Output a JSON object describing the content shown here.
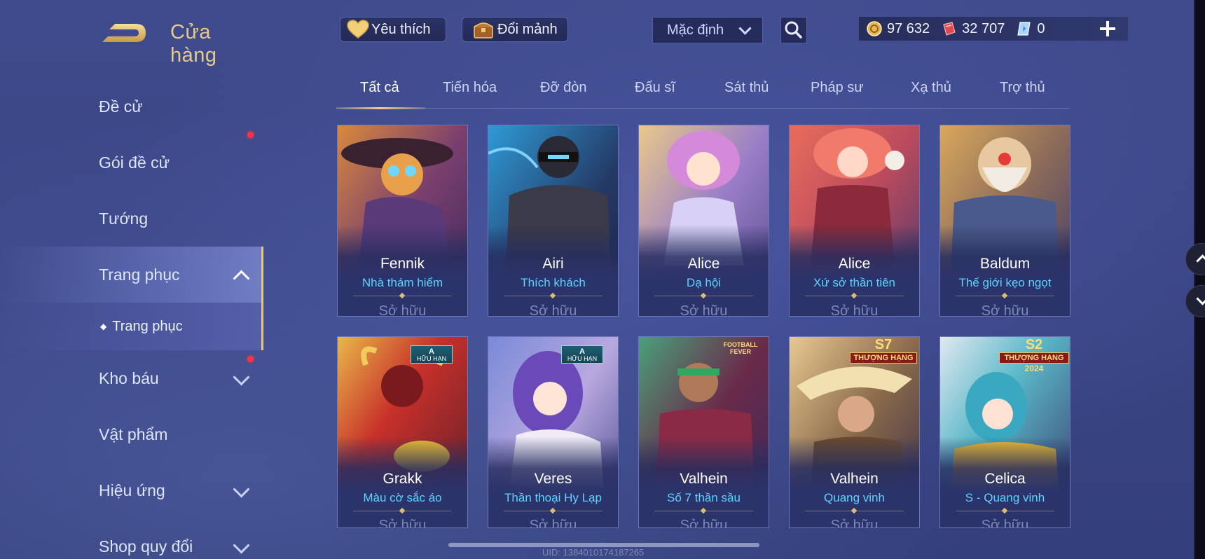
{
  "header": {
    "title": "Cửa hàng",
    "favorites_label": "Yêu thích",
    "trade_label": "Đổi mảnh",
    "sort_selected": "Mặc định"
  },
  "currency": {
    "gold": "97 632",
    "vouchers": "32 707",
    "diamonds": "0"
  },
  "sidebar": {
    "items": [
      {
        "label": "Đề cử"
      },
      {
        "label": "Gói đề cử"
      },
      {
        "label": "Tướng"
      },
      {
        "label": "Trang phục"
      },
      {
        "label": "Trang phục"
      },
      {
        "label": "Kho báu"
      },
      {
        "label": "Vật phẩm"
      },
      {
        "label": "Hiệu ứng"
      },
      {
        "label": "Shop quy đổi"
      }
    ]
  },
  "tabs": [
    {
      "label": "Tất cả"
    },
    {
      "label": "Tiến hóa"
    },
    {
      "label": "Đỡ đòn"
    },
    {
      "label": "Đấu sĩ"
    },
    {
      "label": "Sát thủ"
    },
    {
      "label": "Pháp sư"
    },
    {
      "label": "Xạ thủ"
    },
    {
      "label": "Trợ thủ"
    }
  ],
  "skins": [
    {
      "hero": "Fennik",
      "skin": "Nhà thám hiểm",
      "status": "Sở hữu"
    },
    {
      "hero": "Airi",
      "skin": "Thích khách",
      "status": "Sở hữu"
    },
    {
      "hero": "Alice",
      "skin": "Dạ hội",
      "status": "Sở hữu"
    },
    {
      "hero": "Alice",
      "skin": "Xứ sở thần tiên",
      "status": "Sở hữu"
    },
    {
      "hero": "Baldum",
      "skin": "Thế giới kẹo ngọt",
      "status": "Sở hữu"
    },
    {
      "hero": "Grakk",
      "skin": "Màu cờ sắc áo",
      "status": "Sở hữu",
      "badge": {
        "top": "A",
        "bottom": "HỮU HẠN"
      }
    },
    {
      "hero": "Veres",
      "skin": "Thần thoại Hy Lạp",
      "status": "Sở hữu",
      "badge": {
        "top": "A",
        "bottom": "HỮU HẠN"
      }
    },
    {
      "hero": "Valhein",
      "skin": "Số 7 thần sầu",
      "status": "Sở hữu",
      "badge": {
        "top": "FOOTBALL",
        "bottom": "FEVER"
      }
    },
    {
      "hero": "Valhein",
      "skin": "Quang vinh",
      "status": "Sở hữu",
      "badge": {
        "top": "S7",
        "bottom": "THƯỢNG HẠNG"
      }
    },
    {
      "hero": "Celica",
      "skin": "S - Quang vinh",
      "status": "Sở hữu",
      "badge": {
        "top": "S2",
        "bottom": "THƯỢNG HẠNG",
        "year": "2024"
      }
    }
  ],
  "footer": {
    "uid": "UID: 1384010174187265"
  },
  "colors": {
    "accent_gold": "#e8c98a",
    "skin_name": "#5fd2ff",
    "notification": "#ff3344"
  },
  "icons": [
    "back-arrow-icon",
    "heart-icon",
    "chest-icon",
    "search-icon",
    "gold-coin-icon",
    "voucher-icon",
    "diamond-icon",
    "plus-icon",
    "chevron-down-icon",
    "chevron-up-icon"
  ]
}
